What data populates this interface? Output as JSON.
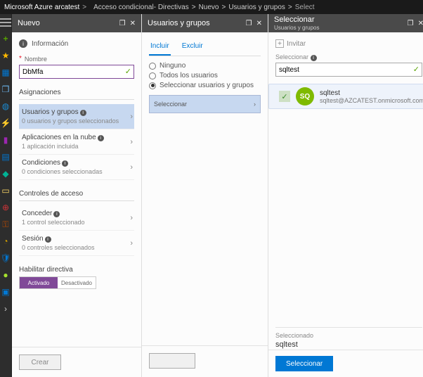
{
  "topbar": {
    "brand": "Microsoft Azure arcatest",
    "crumbs": [
      "Acceso condicional- Directivas",
      "Nuevo",
      "Usuarios y grupos"
    ],
    "final": "Select",
    "sep": ">"
  },
  "leftnav": {
    "collapse_tooltip": "Menú",
    "items": [
      "plus",
      "star",
      "grid",
      "cube",
      "globe",
      "bolt",
      "bar",
      "sql",
      "diam",
      "card",
      "ring",
      "key",
      "moni",
      "shld",
      "dot",
      "host",
      "chev"
    ]
  },
  "bladeA": {
    "title": "Nuevo",
    "info_label": "Información",
    "name_label": "Nombre",
    "name_value": "DbMfa",
    "assign_section": "Asignaciones",
    "rows": {
      "users": {
        "label": "Usuarios y grupos",
        "sub": "0 usuarios y grupos seleccionados"
      },
      "apps": {
        "label": "Aplicaciones en la nube",
        "sub": "1 aplicación incluida"
      },
      "cond": {
        "label": "Condiciones",
        "sub": "0 condiciones seleccionadas"
      }
    },
    "controls_section": "Controles de acceso",
    "controls": {
      "grant": {
        "label": "Conceder",
        "sub": "1 control seleccionado"
      },
      "sess": {
        "label": "Sesión",
        "sub": "0 controles seleccionados"
      }
    },
    "enable_label": "Habilitar directiva",
    "enable_on": "Activado",
    "enable_off": "Desactivado",
    "create_btn": "Crear"
  },
  "bladeB": {
    "title": "Usuarios y grupos",
    "tab_include": "Incluir",
    "tab_exclude": "Excluir",
    "radio_none": "Ninguno",
    "radio_all": "Todos los usuarios",
    "radio_sel": "Seleccionar usuarios y grupos",
    "select_label": "Seleccionar"
  },
  "bladeC": {
    "title": "Seleccionar",
    "subtitle": "Usuarios y grupos",
    "add_label": "Invitar",
    "search_label": "Seleccionar",
    "search_value": "sqltest",
    "user": {
      "initials": "SQ",
      "name": "sqltest",
      "email": "sqltest@AZCATEST.onmicrosoft.com"
    },
    "selected_label": "Seleccionado",
    "selected_value": "sqltest",
    "select_btn": "Seleccionar"
  }
}
